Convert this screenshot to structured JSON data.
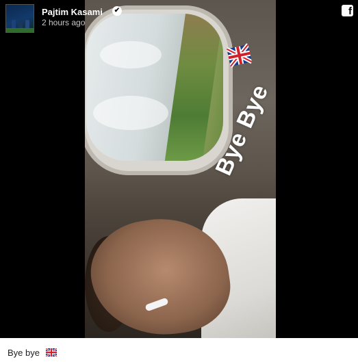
{
  "post": {
    "author_name": "Pajtim Kasami",
    "verified_mark": "✔",
    "timestamp": "2 hours ago",
    "platform_icon": "facebook-icon",
    "platform_glyph": "f"
  },
  "photo": {
    "sticker_text": "Bye Bye",
    "sticker_emoji": "uk-flag-icon"
  },
  "caption": {
    "text": "Bye bye",
    "emoji": "uk-flag-icon"
  },
  "colors": {
    "background": "#000000",
    "caption_background": "#ffffff",
    "caption_text": "#1c1e21",
    "header_text": "#ffffff"
  }
}
